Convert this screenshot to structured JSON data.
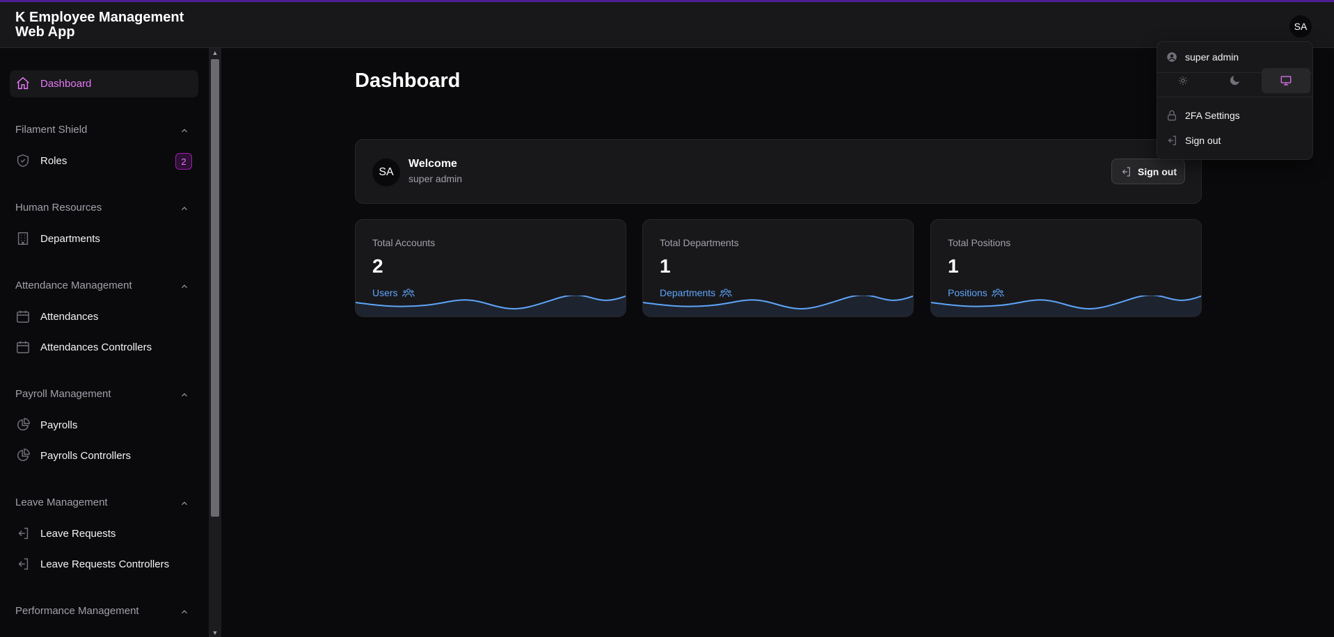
{
  "app": {
    "title": "K Employee Management Web App"
  },
  "header": {
    "avatar_initials": "SA"
  },
  "sidebar": {
    "dashboard": "Dashboard",
    "groups": {
      "filament_shield": {
        "label": "Filament Shield",
        "roles": "Roles",
        "roles_badge": "2"
      },
      "human_resources": {
        "label": "Human Resources",
        "departments": "Departments"
      },
      "attendance": {
        "label": "Attendance Management",
        "attendances": "Attendances",
        "attendances_controllers": "Attendances Controllers"
      },
      "payroll": {
        "label": "Payroll Management",
        "payrolls": "Payrolls",
        "payrolls_controllers": "Payrolls Controllers"
      },
      "leave": {
        "label": "Leave Management",
        "leave_requests": "Leave Requests",
        "leave_requests_controllers": "Leave Requests Controllers"
      },
      "performance": {
        "label": "Performance Management"
      }
    }
  },
  "main": {
    "page_title": "Dashboard",
    "welcome": {
      "avatar_initials": "SA",
      "title": "Welcome",
      "user": "super admin",
      "sign_out": "Sign out"
    },
    "stats": [
      {
        "label": "Total Accounts",
        "value": "2",
        "link": "Users"
      },
      {
        "label": "Total Departments",
        "value": "1",
        "link": "Departments"
      },
      {
        "label": "Total Positions",
        "value": "1",
        "link": "Positions"
      }
    ]
  },
  "user_menu": {
    "user": "super admin",
    "theme_selected": "system",
    "two_fa": "2FA Settings",
    "sign_out": "Sign out"
  },
  "colors": {
    "accent": "#e879f9",
    "link": "#60a5fa",
    "background": "#0a0a0c",
    "panel": "#18181b"
  }
}
